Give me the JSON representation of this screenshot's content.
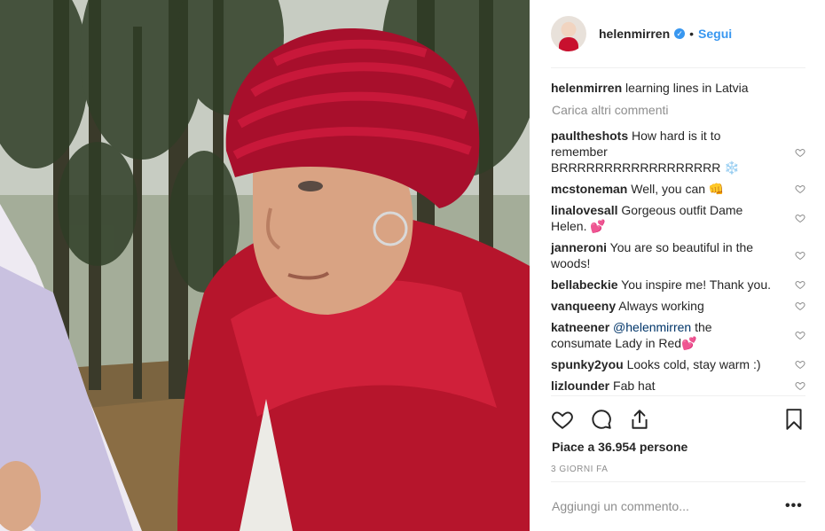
{
  "post": {
    "username": "helenmirren",
    "follow_label": "Segui",
    "separator": "•",
    "caption_user": "helenmirren",
    "caption_text": "learning lines in Latvia",
    "load_more": "Carica altri commenti",
    "likes": "Piace a 36.954 persone",
    "date": "3 GIORNI FA",
    "add_comment_placeholder": "Aggiungi un commento...",
    "more_options": "•••"
  },
  "comments": [
    {
      "user": "paultheshots",
      "text": "How hard is it to remember BRRRRRRRRRRRRRRRRRR ❄️"
    },
    {
      "user": "mcstoneman",
      "text": "Well, you can 👊"
    },
    {
      "user": "linalovesall",
      "text": "Gorgeous outfit Dame Helen. 💕"
    },
    {
      "user": "janneroni",
      "text": "You are so beautiful in the woods!"
    },
    {
      "user": "bellabeckie",
      "text": "You inspire me! Thank you."
    },
    {
      "user": "vanqueeny",
      "text": "Always working"
    },
    {
      "user": "katneener",
      "mention": "@helenmirren",
      "text": " the consumate Lady in Red💕"
    },
    {
      "user": "spunky2you",
      "text": "Looks cold, stay warm :)"
    },
    {
      "user": "lizlounder",
      "text": "Fab hat"
    }
  ],
  "icons": {
    "like": "heart-icon",
    "comment": "comment-bubble-icon",
    "share": "share-icon",
    "save": "bookmark-icon",
    "verified": "verified-badge-icon"
  },
  "colors": {
    "link": "#3897f0",
    "muted": "#8e8e8e",
    "hat_scarf": "#c8102e"
  }
}
